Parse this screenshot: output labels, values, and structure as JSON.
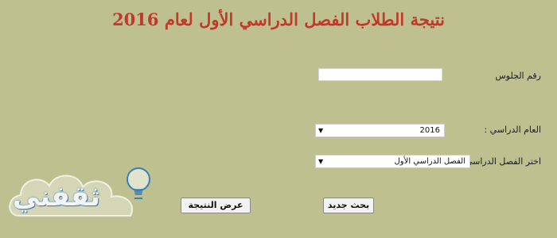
{
  "title": "نتيجة الطلاب الفصل الدراسي الأول لعام 2016",
  "form": {
    "seat_number_label": "رقم الجلوس",
    "seat_number_value": "",
    "year_label": "العام الدراسي :",
    "year_value": "2016",
    "semester_label": "اختر الفصل الدراسي :",
    "semester_value": "الفصل الدراسي الأول"
  },
  "buttons": {
    "new_search": "بحث جديد",
    "show_result": "عرض النتيجة"
  },
  "watermark": {
    "text": "ثقفني"
  },
  "colors": {
    "background": "#bfc08f",
    "title": "#c0392b",
    "watermark_blue": "#3a7fb5"
  },
  "icons": {
    "dropdown": "triangle-down",
    "watermark": "lightbulb-cloud"
  }
}
